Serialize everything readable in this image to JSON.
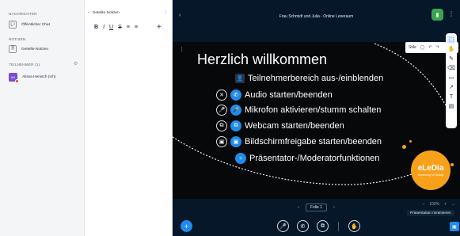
{
  "left": {
    "sections": {
      "messages": "NACHRICHTEN",
      "notes": "NOTIZEN",
      "participants": "TEILNEHMER (1)"
    },
    "public_chat": "Öffentlicher Chat",
    "shared_notes": "Geteilte Notizen",
    "participant": {
      "name": "Alissa Henisch (Ich)",
      "initials": "AH"
    }
  },
  "notes_panel": {
    "header": "Geteilte Notizen",
    "toolbar": [
      "B",
      "I",
      "U",
      "S",
      "≡",
      "≡"
    ],
    "plus": "+"
  },
  "topbar": {
    "title": "Frau Schmidt und Julia - Online Leseraum",
    "back_icon": "‹",
    "menu_icon": "⋮"
  },
  "slide": {
    "title": "Herzlich willkommen",
    "lines": [
      "Teilnehmerbereich aus-/einblenden",
      "Audio starten/beenden",
      "Mikrofon aktivieren/stumm schalten",
      "Webcam starten/beenden",
      "Bildschirmfreigabe starten/beenden",
      "Präsentator-/Moderatorfunktionen"
    ],
    "logo_main": "eLeDia",
    "logo_sub": "eLearning im Dialog"
  },
  "style_box": {
    "label": "Stile",
    "undo": "↶",
    "redo": "↷"
  },
  "page_controls": {
    "prev": "‹",
    "page": "Folie 1",
    "next": "›"
  },
  "zoom": {
    "minus": "–",
    "level": "100%",
    "plus": "+",
    "fit": "↔"
  },
  "tooltip": "Präsentation minimieren"
}
